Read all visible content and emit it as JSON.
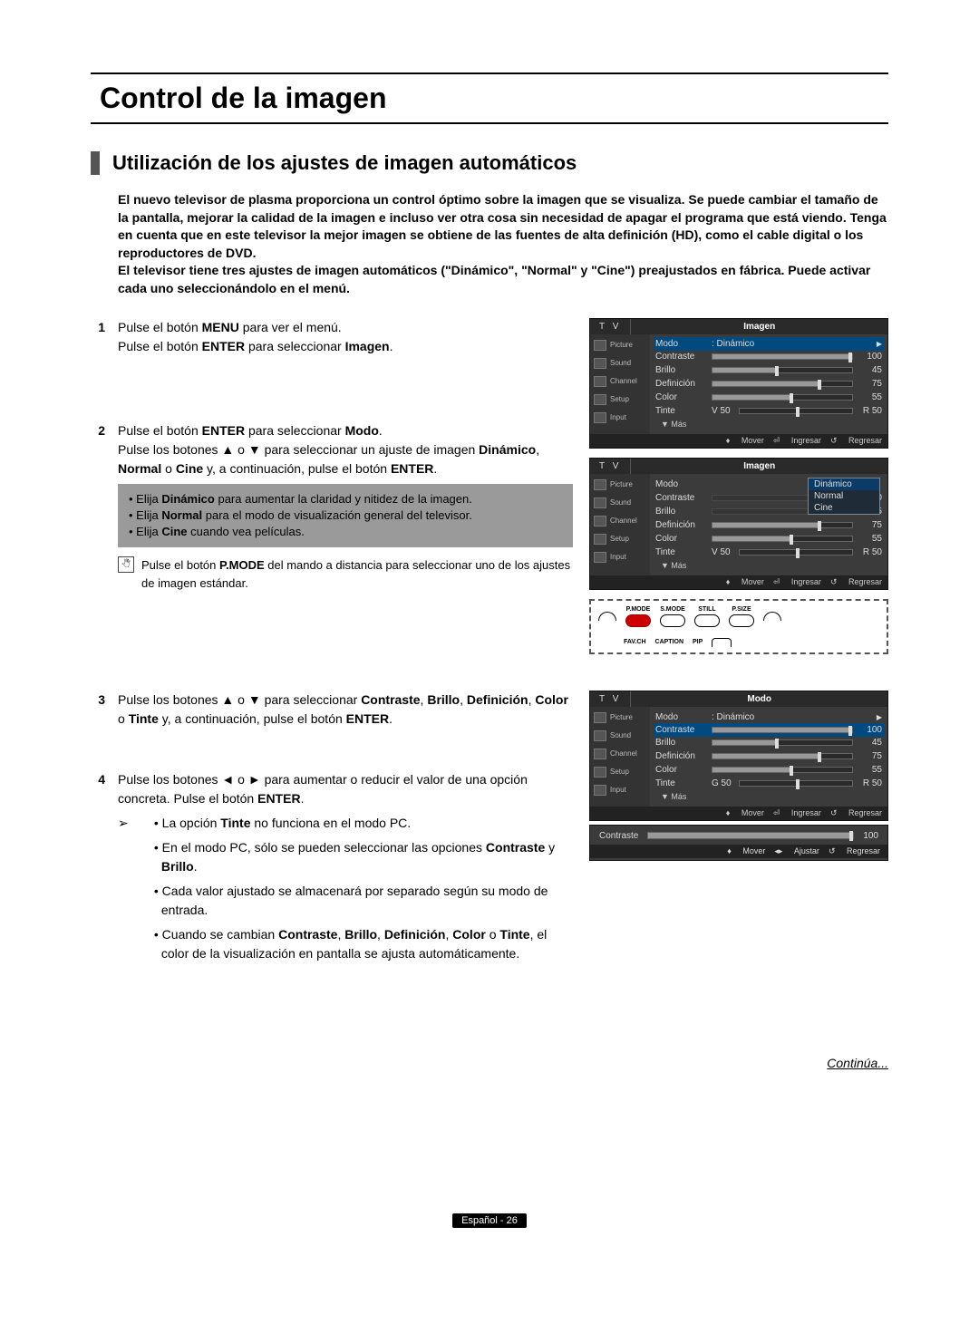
{
  "title": "Control de la imagen",
  "section": "Utilización de los ajustes de imagen automáticos",
  "intro": "El nuevo televisor de plasma proporciona un control óptimo sobre la imagen que se visualiza. Se puede cambiar el tamaño de la pantalla, mejorar la calidad de la imagen e incluso ver otra cosa sin necesidad de apagar el programa que está viendo. Tenga en cuenta que en este televisor la mejor imagen se obtiene de las fuentes de alta definición (HD), como el cable digital o los reproductores de DVD.\nEl televisor tiene tres ajustes de imagen automáticos (\"Dinámico\", \"Normal\" y \"Cine\") preajustados en fábrica. Puede activar cada uno seleccionándolo en el menú.",
  "steps": {
    "s1": {
      "num": "1",
      "a": "Pulse el botón ",
      "b": "MENU",
      "c": " para ver el menú.",
      "d": "Pulse el botón ",
      "e": "ENTER",
      "f": " para seleccionar ",
      "g": "Imagen",
      "h": "."
    },
    "s2": {
      "num": "2",
      "a": "Pulse el botón ",
      "b": "ENTER",
      "c": " para seleccionar ",
      "d": "Modo",
      "e": ".",
      "f": "Pulse los botones ▲ o ▼ para seleccionar un ajuste de imagen ",
      "g": "Dinámico",
      "h": ", ",
      "i": "Normal",
      "j": " o ",
      "k": "Cine",
      "l": " y, a continuación, pulse el botón ",
      "m": "ENTER",
      "n": "."
    },
    "hints": {
      "a": "• Elija ",
      "ab": "Dinámico",
      "ac": " para aumentar la claridad y nitidez de la imagen.",
      "b": "• Elija ",
      "bb": "Normal",
      "bc": " para el modo de visualización general del televisor.",
      "c": "• Elija ",
      "cb": "Cine",
      "cc": " cuando vea películas."
    },
    "pmode": {
      "a": "Pulse el botón ",
      "b": "P.MODE",
      "c": " del mando a distancia para seleccionar uno de los ajustes de imagen estándar."
    },
    "s3": {
      "num": "3",
      "a": "Pulse los botones ▲ o ▼ para seleccionar ",
      "b": "Contraste",
      "c": ", ",
      "d": "Brillo",
      "e": ", ",
      "f": "Definición",
      "g": ", ",
      "h": "Color",
      "i": " o ",
      "j": "Tinte",
      "k": " y, a continuación, pulse el botón ",
      "l": "ENTER",
      "m": "."
    },
    "s4": {
      "num": "4",
      "a": "Pulse los botones ◄ o ► para aumentar o reducir el valor de una opción concreta. Pulse el botón ",
      "b": "ENTER",
      "c": "."
    },
    "notes": {
      "lead": "➢",
      "n1a": "• La opción ",
      "n1b": "Tinte",
      "n1c": " no funciona en el modo PC.",
      "n2a": "• En el modo PC, sólo se pueden seleccionar las opciones ",
      "n2b": "Contraste",
      "n2c": " y ",
      "n2d": "Brillo",
      "n2e": ".",
      "n3": "• Cada valor ajustado se almacenará por separado según su modo de entrada.",
      "n4a": "• Cuando se cambian ",
      "n4b": "Contraste",
      "n4c": ", ",
      "n4d": "Brillo",
      "n4e": ", ",
      "n4f": "Definición",
      "n4g": ", ",
      "n4h": "Color",
      "n4i": " o ",
      "n4j": "Tinte",
      "n4k": ", el color de la visualización en pantalla se ajusta automáticamente."
    }
  },
  "continua": "Continúa...",
  "footer": "Español - 26",
  "osd_side": {
    "picture": "Picture",
    "sound": "Sound",
    "channel": "Channel",
    "setup": "Setup",
    "input": "Input"
  },
  "osd_foot": {
    "mover": "Mover",
    "ingresar": "Ingresar",
    "regresar": "Regresar",
    "ajustar": "Ajustar"
  },
  "osd_more": "▼ Más",
  "osd1": {
    "tv": "T V",
    "header": "Imagen",
    "modo": "Modo",
    "modo_val": ": Dinámico",
    "contraste": "Contraste",
    "contraste_v": "100",
    "brillo": "Brillo",
    "brillo_v": "45",
    "definicion": "Definición",
    "definicion_v": "75",
    "color": "Color",
    "color_v": "55",
    "tinte": "Tinte",
    "tinte_l": "V 50",
    "tinte_r": "R 50"
  },
  "osd2": {
    "tv": "T V",
    "header": "Imagen",
    "modo": "Modo",
    "dd": {
      "dinamico": "Dinámico",
      "normal": "Normal",
      "cine": "Cine"
    },
    "contraste": "Contraste",
    "contraste_v": "100",
    "brillo": "Brillo",
    "brillo_v": "45",
    "definicion": "Definición",
    "definicion_v": "75",
    "color": "Color",
    "color_v": "55",
    "tinte": "Tinte",
    "tinte_l": "V 50",
    "tinte_r": "R 50"
  },
  "osd3": {
    "tv": "T V",
    "header": "Modo",
    "modo": "Modo",
    "modo_val": ": Dinámico",
    "contraste": "Contraste",
    "contraste_v": "100",
    "brillo": "Brillo",
    "brillo_v": "45",
    "definicion": "Definición",
    "definicion_v": "75",
    "color": "Color",
    "color_v": "55",
    "tinte": "Tinte",
    "tinte_l": "G 50",
    "tinte_r": "R 50"
  },
  "adjust": {
    "label": "Contraste",
    "value": "100"
  },
  "remote": {
    "pmode": "P.MODE",
    "smode": "S.MODE",
    "still": "STILL",
    "psize": "P.SIZE",
    "favch": "FAV.CH",
    "caption": "CAPTION",
    "pip": "PIP"
  }
}
